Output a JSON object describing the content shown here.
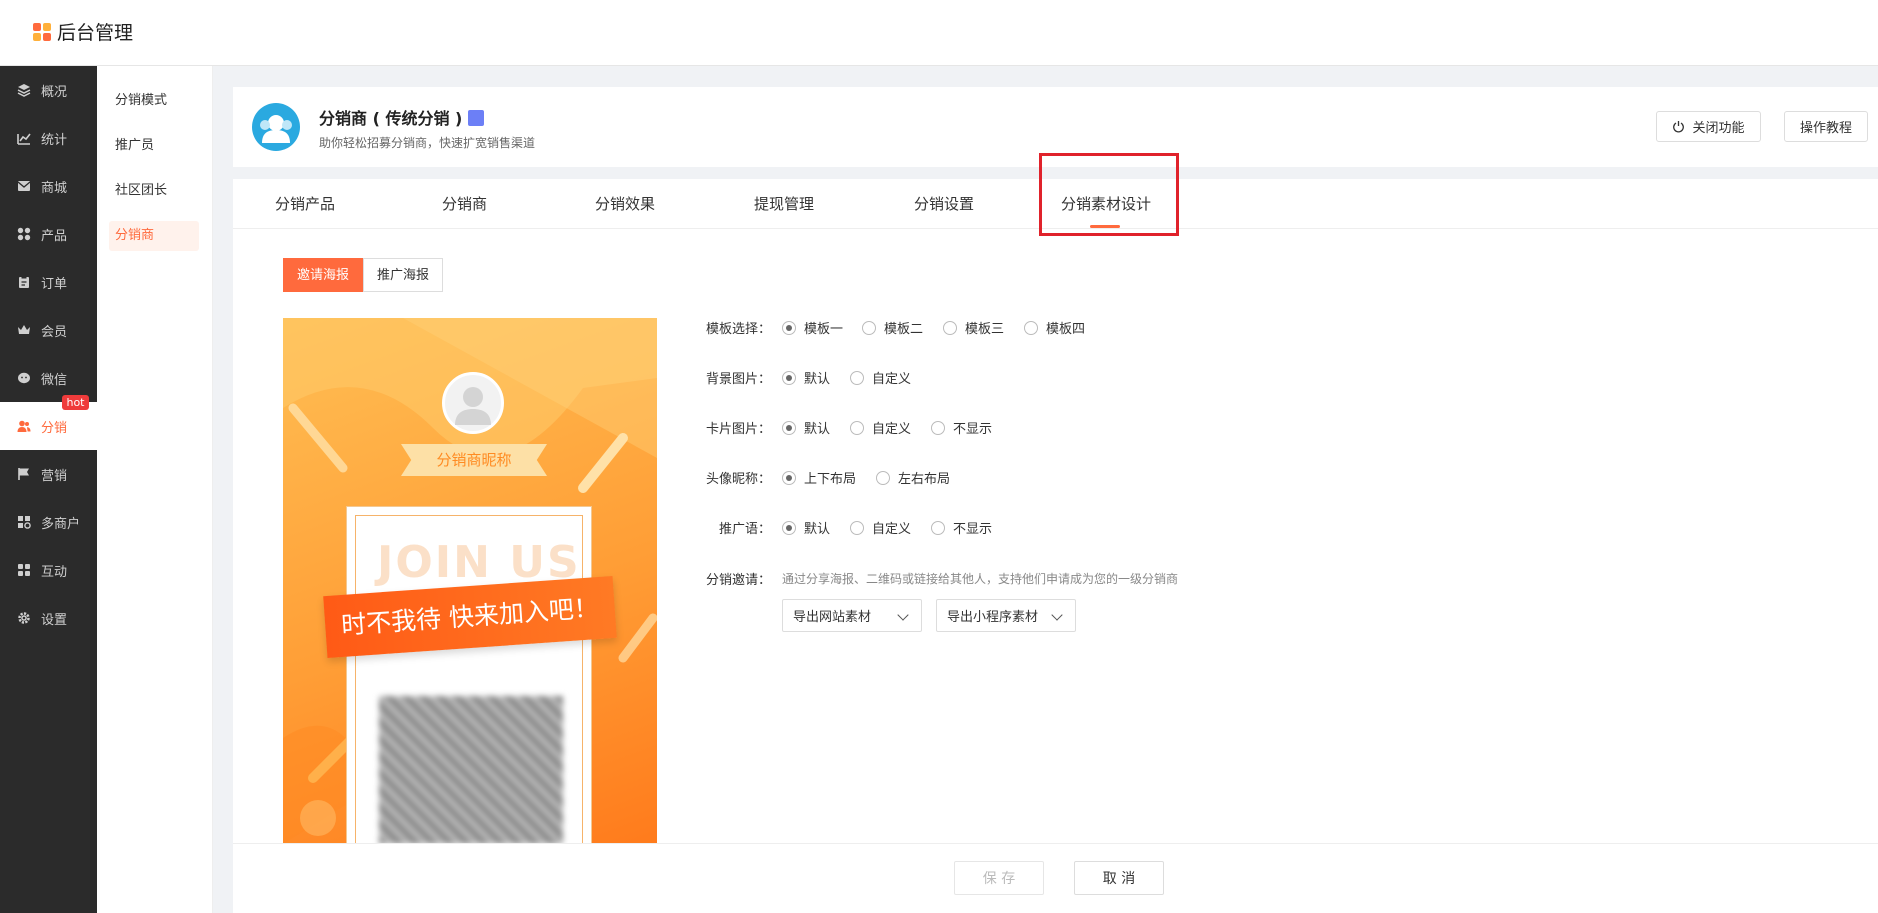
{
  "app": {
    "title": "后台管理"
  },
  "sidebar": {
    "items": [
      {
        "label": "概况",
        "icon": "layers-icon"
      },
      {
        "label": "统计",
        "icon": "chart-icon"
      },
      {
        "label": "商城",
        "icon": "mail-icon"
      },
      {
        "label": "产品",
        "icon": "grid-icon"
      },
      {
        "label": "订单",
        "icon": "clipboard-icon"
      },
      {
        "label": "会员",
        "icon": "crown-icon"
      },
      {
        "label": "微信",
        "icon": "wechat-icon"
      },
      {
        "label": "分销",
        "icon": "users-icon"
      },
      {
        "label": "营销",
        "icon": "flag-icon"
      },
      {
        "label": "多商户",
        "icon": "store-icon"
      },
      {
        "label": "互动",
        "icon": "interact-icon"
      },
      {
        "label": "设置",
        "icon": "gear-icon"
      }
    ],
    "hot_badge": "hot",
    "accent": "#ff6a3d"
  },
  "subnav": {
    "items": [
      {
        "label": "分销模式"
      },
      {
        "label": "推广员"
      },
      {
        "label": "社区团长"
      },
      {
        "label": "分销商"
      }
    ]
  },
  "header": {
    "title": "分销商 ( 传统分销 )",
    "subtitle": "助你轻松招募分销商，快速扩宽销售渠道",
    "close_label": "关闭功能",
    "tutorial_label": "操作教程"
  },
  "tabs": [
    {
      "label": "分销产品"
    },
    {
      "label": "分销商"
    },
    {
      "label": "分销效果"
    },
    {
      "label": "提现管理"
    },
    {
      "label": "分销设置"
    },
    {
      "label": "分销素材设计"
    }
  ],
  "segments": {
    "invite": "邀请海报",
    "promo": "推广海报"
  },
  "poster": {
    "nickname": "分销商昵称",
    "watermark": "JOIN US",
    "slogan": "时不我待 快来加入吧！"
  },
  "form": {
    "template": {
      "label": "模板选择：",
      "options": [
        "模板一",
        "模板二",
        "模板三",
        "模板四"
      ]
    },
    "background": {
      "label": "背景图片：",
      "options": [
        "默认",
        "自定义"
      ]
    },
    "card": {
      "label": "卡片图片：",
      "options": [
        "默认",
        "自定义",
        "不显示"
      ]
    },
    "avatar_nick": {
      "label": "头像昵称：",
      "options": [
        "上下布局",
        "左右布局"
      ]
    },
    "slogan": {
      "label": "推广语：",
      "options": [
        "默认",
        "自定义",
        "不显示"
      ]
    },
    "invite": {
      "label": "分销邀请：",
      "hint": "通过分享海报、二维码或链接给其他人，支持他们申请成为您的一级分销商",
      "export_web": "导出网站素材",
      "export_mini": "导出小程序素材"
    }
  },
  "footer": {
    "save": "保 存",
    "cancel": "取 消"
  }
}
